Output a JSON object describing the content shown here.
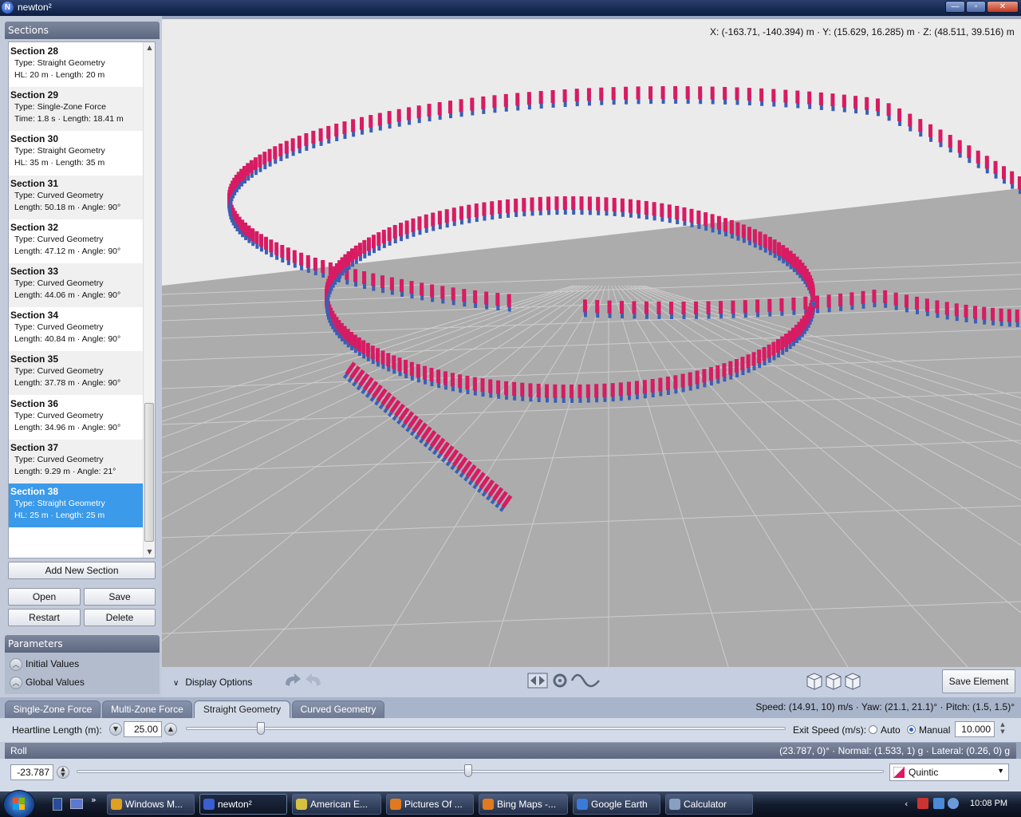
{
  "window": {
    "title": "newton²",
    "icon_letter": "N"
  },
  "sections_panel": {
    "title": "Sections",
    "items": [
      {
        "title": "Section 28",
        "line1": "Type: Straight Geometry",
        "line2": "HL: 20 m · Length: 20 m"
      },
      {
        "title": "Section 29",
        "line1": "Type: Single-Zone Force",
        "line2": "Time: 1.8 s · Length: 18.41 m"
      },
      {
        "title": "Section 30",
        "line1": "Type: Straight Geometry",
        "line2": "HL: 35 m · Length: 35 m"
      },
      {
        "title": "Section 31",
        "line1": "Type: Curved Geometry",
        "line2": "Length: 50.18 m · Angle: 90°"
      },
      {
        "title": "Section 32",
        "line1": "Type: Curved Geometry",
        "line2": "Length: 47.12 m · Angle: 90°"
      },
      {
        "title": "Section 33",
        "line1": "Type: Curved Geometry",
        "line2": "Length: 44.06 m · Angle: 90°"
      },
      {
        "title": "Section 34",
        "line1": "Type: Curved Geometry",
        "line2": "Length: 40.84 m · Angle: 90°"
      },
      {
        "title": "Section 35",
        "line1": "Type: Curved Geometry",
        "line2": "Length: 37.78 m · Angle: 90°"
      },
      {
        "title": "Section 36",
        "line1": "Type: Curved Geometry",
        "line2": "Length: 34.96 m · Angle: 90°"
      },
      {
        "title": "Section 37",
        "line1": "Type: Curved Geometry",
        "line2": "Length: 9.29 m · Angle: 21°"
      },
      {
        "title": "Section 38",
        "line1": "Type: Straight Geometry",
        "line2": "HL: 25 m · Length: 25 m",
        "selected": true
      }
    ],
    "buttons": {
      "add": "Add New Section",
      "open": "Open",
      "save": "Save",
      "restart": "Restart",
      "delete": "Delete"
    }
  },
  "parameters_panel": {
    "title": "Parameters",
    "initial": "Initial Values",
    "global": "Global Values"
  },
  "viewport": {
    "coords": "X: (-163.71, -140.394) m  ·  Y: (15.629, 16.285) m  ·  Z: (48.511, 39.516) m"
  },
  "toolbar": {
    "display_options": "Display Options",
    "save_element": "Save Element"
  },
  "tabs": [
    {
      "label": "Single-Zone Force",
      "active": false
    },
    {
      "label": "Multi-Zone Force",
      "active": false
    },
    {
      "label": "Straight Geometry",
      "active": true
    },
    {
      "label": "Curved Geometry",
      "active": false
    }
  ],
  "stats": "Speed: (14.91, 10) m/s · Yaw: (21.1, 21.1)° · Pitch: (1.5, 1.5)°",
  "params": {
    "heartline_label": "Heartline Length (m):",
    "heartline_value": "25.00",
    "heartline_fraction": 0.125,
    "exit_speed_label": "Exit Speed (m/s):",
    "auto_label": "Auto",
    "manual_label": "Manual",
    "exit_speed_value": "10.000",
    "exit_mode": "Manual"
  },
  "roll": {
    "title": "Roll",
    "stats": "(23.787, 0)° · Normal: (1.533, 1) g · Lateral: (0.26, 0) g",
    "value": "-23.787",
    "fraction": 0.485,
    "interpolation": "Quintic"
  },
  "taskbar": {
    "tasks": [
      {
        "label": "Windows M...",
        "color": "#e0a020"
      },
      {
        "label": "newton²",
        "color": "#3a5fd0",
        "active": true
      },
      {
        "label": "American E...",
        "color": "#d8c040"
      },
      {
        "label": "Pictures Of ...",
        "color": "#e07a20"
      },
      {
        "label": "Bing Maps -...",
        "color": "#e07a20"
      },
      {
        "label": "Google Earth",
        "color": "#3a7ad8"
      },
      {
        "label": "Calculator",
        "color": "#8aa0c0"
      }
    ],
    "clock": "10:08 PM"
  },
  "colors": {
    "track_pink": "#d81b62",
    "track_blue": "#3a5fb5",
    "selection": "#3b9aea"
  }
}
